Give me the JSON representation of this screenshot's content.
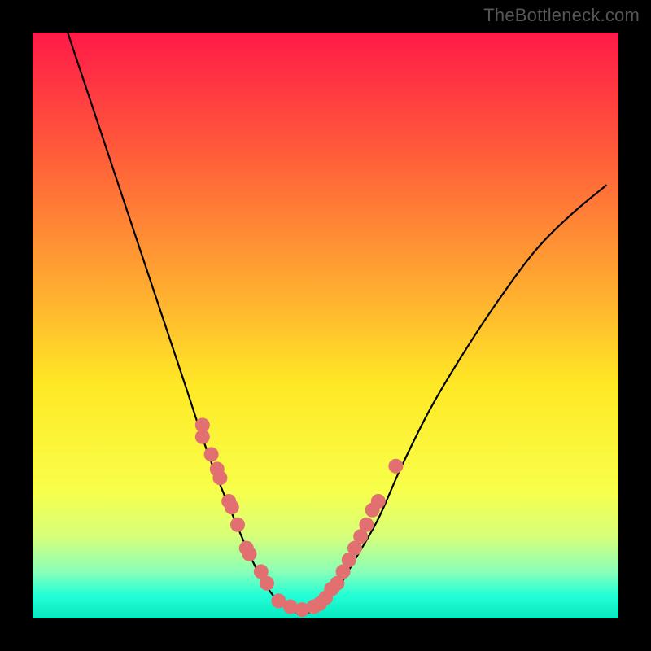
{
  "watermark": "TheBottleneck.com",
  "chart_data": {
    "type": "line",
    "title": "",
    "xlabel": "",
    "ylabel": "",
    "xlim": [
      0,
      100
    ],
    "ylim": [
      0,
      100
    ],
    "gradient_stops": [
      {
        "offset": 0,
        "color": "#ff1a48"
      },
      {
        "offset": 20,
        "color": "#ff5a3a"
      },
      {
        "offset": 45,
        "color": "#ffb030"
      },
      {
        "offset": 60,
        "color": "#ffe825"
      },
      {
        "offset": 78,
        "color": "#f8ff4a"
      },
      {
        "offset": 86,
        "color": "#d7ff7a"
      },
      {
        "offset": 92,
        "color": "#8affb8"
      },
      {
        "offset": 96,
        "color": "#24ffd6"
      },
      {
        "offset": 100,
        "color": "#08e8c2"
      }
    ],
    "series": [
      {
        "name": "curve",
        "x": [
          6,
          10,
          14,
          18,
          22,
          26,
          30,
          34,
          37,
          39,
          41,
          43,
          45,
          47,
          49,
          52,
          55,
          59,
          63,
          68,
          74,
          80,
          86,
          92,
          98
        ],
        "y": [
          100,
          88,
          76,
          64,
          52,
          40,
          28,
          18,
          11,
          7,
          4,
          2,
          1,
          1,
          2,
          5,
          10,
          17,
          26,
          36,
          46,
          55,
          63,
          69,
          74
        ]
      }
    ],
    "markers": [
      {
        "x": 29,
        "y": 33
      },
      {
        "x": 29,
        "y": 31
      },
      {
        "x": 30.5,
        "y": 28
      },
      {
        "x": 31.5,
        "y": 25.5
      },
      {
        "x": 32,
        "y": 24
      },
      {
        "x": 33.5,
        "y": 20
      },
      {
        "x": 34,
        "y": 19
      },
      {
        "x": 35,
        "y": 16
      },
      {
        "x": 36.5,
        "y": 12
      },
      {
        "x": 37,
        "y": 11
      },
      {
        "x": 39,
        "y": 8
      },
      {
        "x": 40,
        "y": 6
      },
      {
        "x": 42,
        "y": 3
      },
      {
        "x": 44,
        "y": 2
      },
      {
        "x": 46,
        "y": 1.5
      },
      {
        "x": 48,
        "y": 2
      },
      {
        "x": 49,
        "y": 2.5
      },
      {
        "x": 50,
        "y": 3.5
      },
      {
        "x": 51,
        "y": 5
      },
      {
        "x": 52,
        "y": 6
      },
      {
        "x": 53,
        "y": 8
      },
      {
        "x": 54,
        "y": 10
      },
      {
        "x": 55,
        "y": 12
      },
      {
        "x": 56,
        "y": 14
      },
      {
        "x": 57,
        "y": 16
      },
      {
        "x": 58,
        "y": 18.5
      },
      {
        "x": 59,
        "y": 20
      },
      {
        "x": 62,
        "y": 26
      }
    ],
    "marker_color": "#e27070",
    "curve_color": "#000000"
  }
}
